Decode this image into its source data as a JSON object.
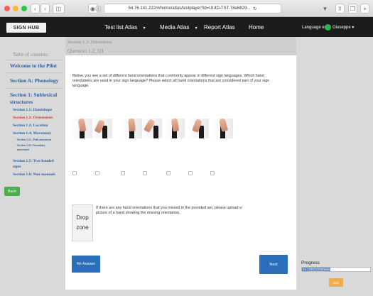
{
  "browser": {
    "url": "54.76.141.222/#/home/atlas/testplayer?id=UUID-TST-78e8829...",
    "colors": {
      "close": "#fc5f57",
      "minimize": "#fdbb2e",
      "maximize": "#29c941"
    }
  },
  "appnav": {
    "logo": "SIGN HUB",
    "links": [
      "Test list Atlas",
      "Media Atlas",
      "Report Atlas",
      "Home"
    ],
    "language": "Language en",
    "user": "Giuseppe"
  },
  "sidebar": {
    "toc_title": "Table of contents:",
    "items": [
      {
        "label": "Welcome to the Pilot"
      },
      {
        "label": "Section A: Phonology"
      },
      {
        "label": "Section 1: Sublexical"
      },
      {
        "label": "structures"
      },
      {
        "label": "Section 1.1: Handshape"
      },
      {
        "label": "Section 1.2: Orientation"
      },
      {
        "label": "Section 1.3: Location"
      },
      {
        "label": "Section 1.4: Movement"
      },
      {
        "label": "- Section 1.4.1: Path movement"
      },
      {
        "label": "- Section 1.4.2: Secondary"
      },
      {
        "label": "movement"
      },
      {
        "label": "Section 1.5: Two-handed"
      },
      {
        "label": "signs"
      },
      {
        "label": "Section 1.6: Non-manuals"
      }
    ],
    "back": "Back"
  },
  "modal": {
    "section": "Section 1.3: Orientation",
    "question": "Question 1.2_Q1",
    "prompt": "Below, you see a set of different hand orientations that commonly appear in different sign languages. Which hand orientations are used in your sign language? Please select all hand orientations that are considered part of your sign language.",
    "drop_zone_line1": "Drop",
    "drop_zone_line2": "zone",
    "missing_text": "If there are any hand orientations that you missed in the provided set, please upload a picture of a hand showing the missing orientation.",
    "no_answer": "No Answer",
    "next": "Next"
  },
  "progress": {
    "label": "Progress",
    "value_text": "42.12903225806452%",
    "percent": 42.129
  },
  "exit": "Exit"
}
